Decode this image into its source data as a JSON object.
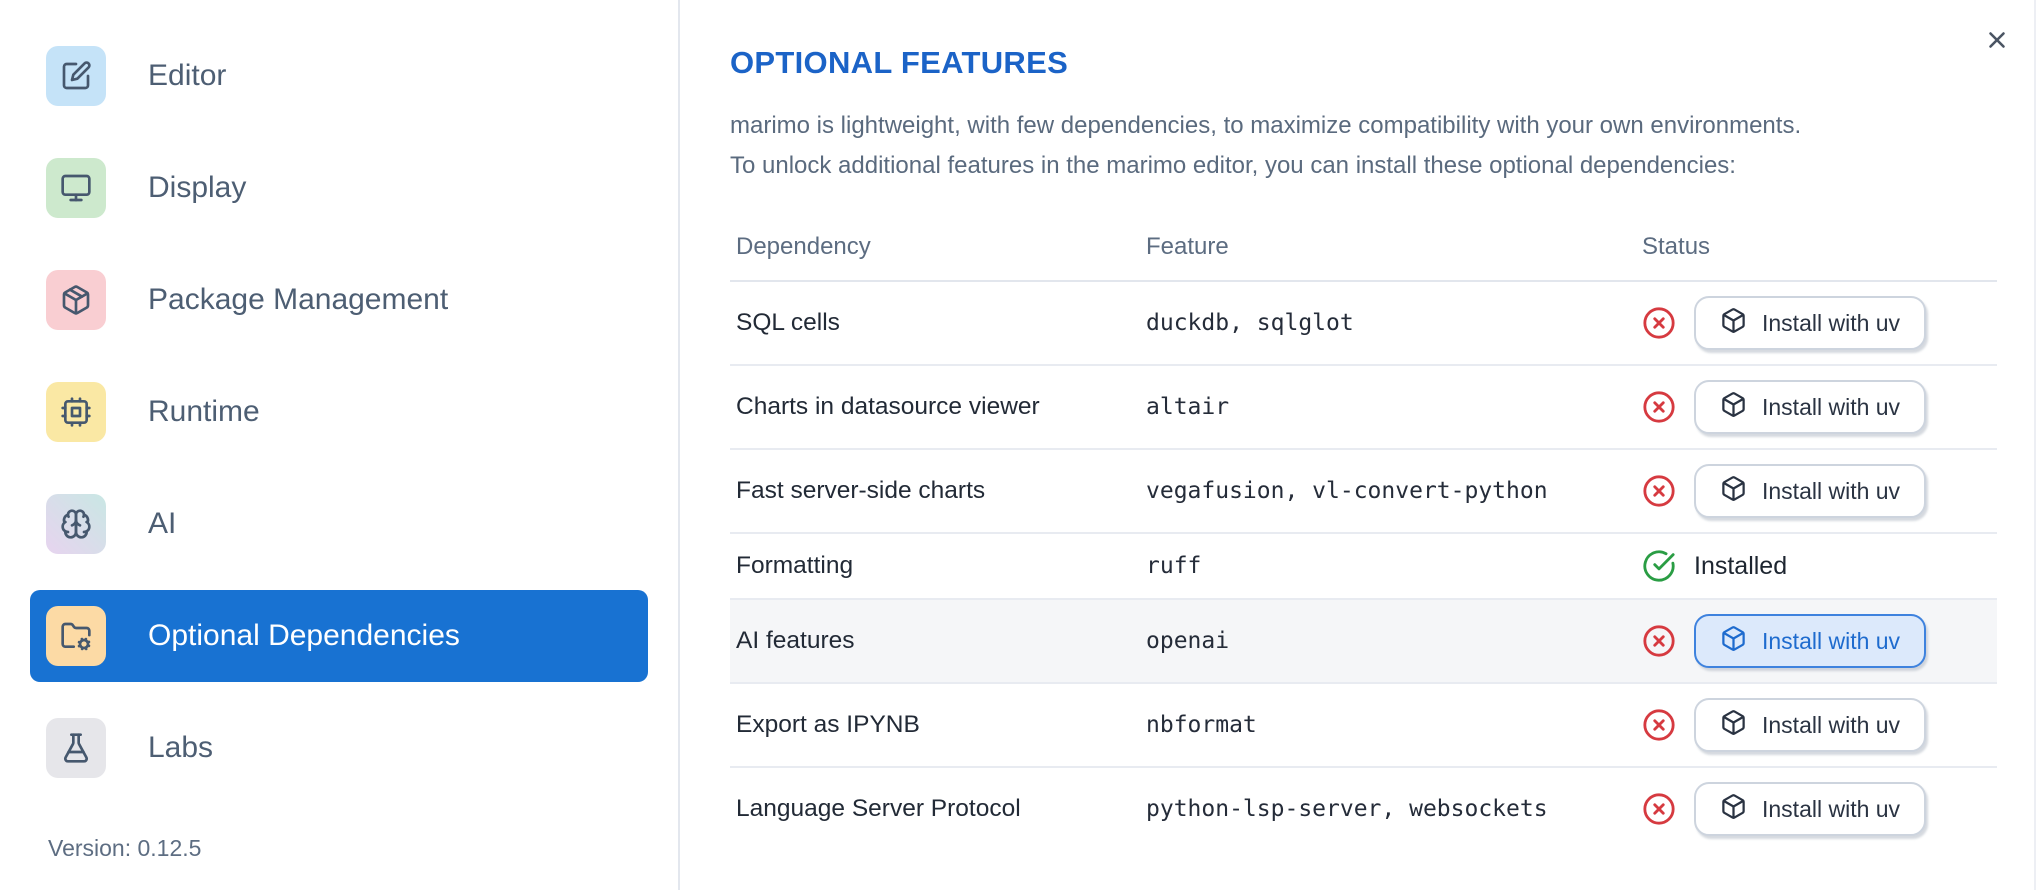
{
  "sidebar": {
    "items": [
      {
        "label": "Editor",
        "icon": "square-pen",
        "bg": "#c5e3f8"
      },
      {
        "label": "Display",
        "icon": "monitor",
        "bg": "#cde9cd"
      },
      {
        "label": "Package Management",
        "icon": "package",
        "bg": "#f9ced2"
      },
      {
        "label": "Runtime",
        "icon": "cpu",
        "bg": "#fae8a4"
      },
      {
        "label": "AI",
        "icon": "brain",
        "bg": "linear-gradient(45deg,#e7d4ef,#c9e7e4)"
      },
      {
        "label": "Optional Dependencies",
        "icon": "folder-cog",
        "bg": "#fcdaa5",
        "selected": true
      },
      {
        "label": "Labs",
        "icon": "flask",
        "bg": "#e6e6ea"
      }
    ],
    "version_label": "Version: 0.12.5"
  },
  "dialog": {
    "title": "OPTIONAL FEATURES",
    "description_lines": [
      "marimo is lightweight, with few dependencies, to maximize compatibility with your own environments.",
      "To unlock additional features in the marimo editor, you can install these optional dependencies:"
    ]
  },
  "table": {
    "headers": [
      "Dependency",
      "Feature",
      "Status"
    ],
    "rows": [
      {
        "dependency": "SQL cells",
        "feature": "duckdb, sqlglot",
        "installed": false,
        "action": "Install with uv"
      },
      {
        "dependency": "Charts in datasource viewer",
        "feature": "altair",
        "installed": false,
        "action": "Install with uv"
      },
      {
        "dependency": "Fast server-side charts",
        "feature": "vegafusion, vl-convert-python",
        "installed": false,
        "action": "Install with uv"
      },
      {
        "dependency": "Formatting",
        "feature": "ruff",
        "installed": true,
        "status_label": "Installed"
      },
      {
        "dependency": "AI features",
        "feature": "openai",
        "installed": false,
        "action": "Install with uv",
        "highlighted": true
      },
      {
        "dependency": "Export as IPYNB",
        "feature": "nbformat",
        "installed": false,
        "action": "Install with uv"
      },
      {
        "dependency": "Language Server Protocol",
        "feature": "python-lsp-server, websockets",
        "installed": false,
        "action": "Install with uv"
      }
    ]
  },
  "colors": {
    "accent_blue": "#1872d2",
    "title_blue": "#1b63c7",
    "error_red": "#d63a40",
    "success_green": "#2a9d44",
    "row_highlight": "#f5f6f8"
  }
}
